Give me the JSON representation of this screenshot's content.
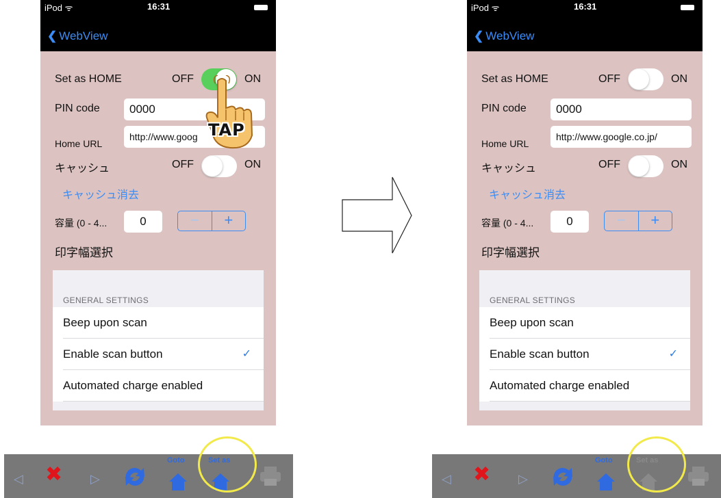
{
  "status_bar": {
    "carrier": "iPod ᯤ",
    "time": "16:31"
  },
  "nav": {
    "back_label": "WebView"
  },
  "form": {
    "home_label": "Set as HOME",
    "off_label": "OFF",
    "on_label": "ON",
    "pin_label": "PIN code",
    "pin_value": "0000",
    "url_label": "Home URL",
    "url_value": "http://www.google.co.jp/",
    "url_value_before": "http://www.goog",
    "cache_label": "キャッシュ",
    "clear_cache_label": "キャッシュ消去",
    "capacity_label": "容量 (0 - 4...",
    "capacity_value": "0",
    "stepper_minus": "−",
    "stepper_plus": "+",
    "print_width_label": "印字幅選択"
  },
  "settings": {
    "section_header": "GENERAL SETTINGS",
    "rows": [
      {
        "label": "Beep upon scan",
        "checked": false
      },
      {
        "label": "Enable scan button",
        "checked": true
      },
      {
        "label": "Automated charge enabled",
        "checked": false
      }
    ]
  },
  "toggles": {
    "before": {
      "home": "on",
      "cache": "off"
    },
    "after": {
      "home": "off",
      "cache": "off"
    }
  },
  "tap_label": "TAP",
  "toolbar": {
    "goto_label": "Goto",
    "set_as_label": "Set as",
    "icons": [
      "back-arrow-icon",
      "stop-icon",
      "forward-arrow-icon",
      "reload-icon",
      "goto-home-icon",
      "set-as-home-icon",
      "print-icon"
    ]
  },
  "colors": {
    "accent": "#3b8cf5",
    "toggle_on": "#5ad05c",
    "highlight_circle": "#f2e94a",
    "panel_bg": "#dcc3c1"
  }
}
